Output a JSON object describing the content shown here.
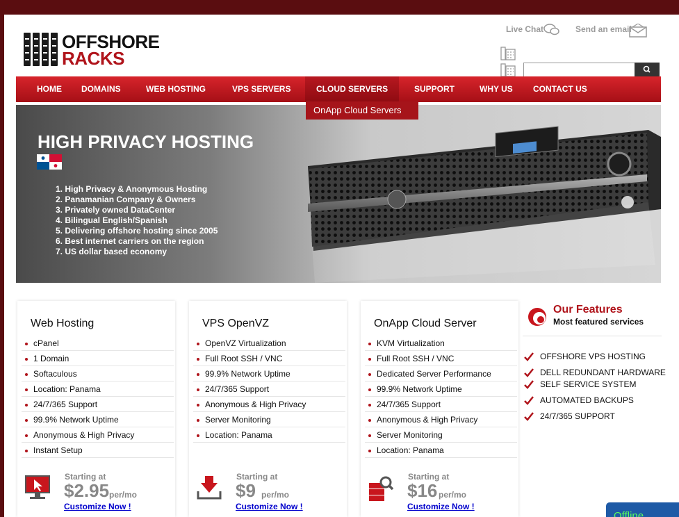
{
  "header": {
    "logo_line1": "OFFSHORE",
    "logo_line2": "RACKS",
    "live_chat": "Live Chat",
    "send_email": "Send an email",
    "search_placeholder": ""
  },
  "nav": {
    "items": [
      "HOME",
      "DOMAINS",
      "WEB HOSTING",
      "VPS SERVERS",
      "CLOUD SERVERS",
      "SUPPORT",
      "WHY US",
      "CONTACT US"
    ],
    "active": "CLOUD SERVERS",
    "dropdown_item": "OnApp Cloud Servers"
  },
  "banner": {
    "title": "HIGH PRIVACY HOSTING",
    "features": [
      "1. High Privacy & Anonymous Hosting",
      "2. Panamanian Company & Owners",
      "3. Privately owned DataCenter",
      "4. Bilingual English/Spanish",
      "5. Delivering offshore hosting since 2005",
      "6. Best internet carriers on the region",
      "7. US dollar based economy"
    ]
  },
  "plans": [
    {
      "title": "Web Hosting",
      "features": [
        "cPanel",
        "1 Domain",
        "Softaculous",
        "Location: Panama",
        "24/7/365 Support",
        "99.9% Network Uptime",
        "Anonymous & High Privacy",
        "Instant Setup"
      ],
      "starting": "Starting at",
      "price": "$2.95",
      "per": "per/mo",
      "cta": "Customize Now !",
      "icon": "monitor-cursor-icon"
    },
    {
      "title": "VPS OpenVZ",
      "features": [
        "OpenVZ Virtualization",
        "Full Root SSH / VNC",
        "99.9% Network Uptime",
        "24/7/365 Support",
        "Anonymous & High Privacy",
        "Server Monitoring",
        "Location: Panama"
      ],
      "starting": "Starting at",
      "price": "$9",
      "per": "per/mo",
      "cta": "Customize Now !",
      "icon": "download-tray-icon"
    },
    {
      "title": "OnApp Cloud Server",
      "features": [
        "KVM Virtualization",
        "Full Root SSH / VNC",
        "Dedicated Server Performance",
        "99.9% Network Uptime",
        "24/7/365 Support",
        "Anonymous & High Privacy",
        "Server Monitoring",
        "Location: Panama"
      ],
      "starting": "Starting at",
      "price": "$16",
      "per": "per/mo",
      "cta": "Customize Now !",
      "icon": "server-search-icon"
    }
  ],
  "our_features": {
    "title": "Our Features",
    "subtitle": "Most featured services",
    "items": [
      "OFFSHORE VPS HOSTING",
      "DELL REDUNDANT HARDWARE",
      "SELF SERVICE SYSTEM",
      "AUTOMATED BACKUPS",
      "24/7/365 SUPPORT"
    ]
  },
  "chat_widget": {
    "status": "Offline"
  },
  "colors": {
    "brand_red": "#b0141b",
    "frame": "#5a0d10",
    "link": "#0000cc"
  }
}
